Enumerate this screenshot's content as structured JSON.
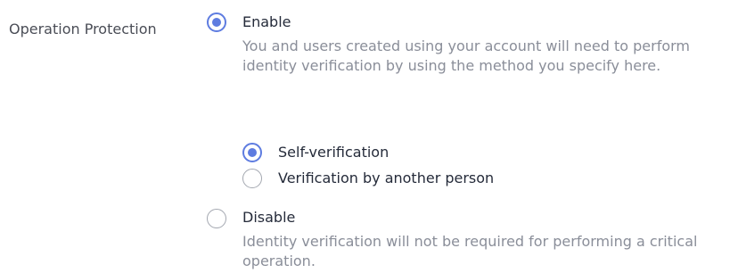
{
  "field": {
    "label": "Operation Protection"
  },
  "enable": {
    "label": "Enable",
    "checked": true,
    "description": "You and users created using your account will need to perform identity verification by using the method you specify here."
  },
  "verification": {
    "self": {
      "label": "Self-verification",
      "checked": true
    },
    "another": {
      "label": "Verification by another person",
      "checked": false
    }
  },
  "disable": {
    "label": "Disable",
    "checked": false,
    "description": "Identity verification will not be required for performing a critical operation."
  },
  "colors": {
    "accent": "#5e7ce0",
    "label_text": "#252b3a",
    "description_text": "#8a8e99",
    "radio_border": "#a3a7b0"
  },
  "icons": [
    "radio-checked-icon",
    "radio-unchecked-icon"
  ]
}
